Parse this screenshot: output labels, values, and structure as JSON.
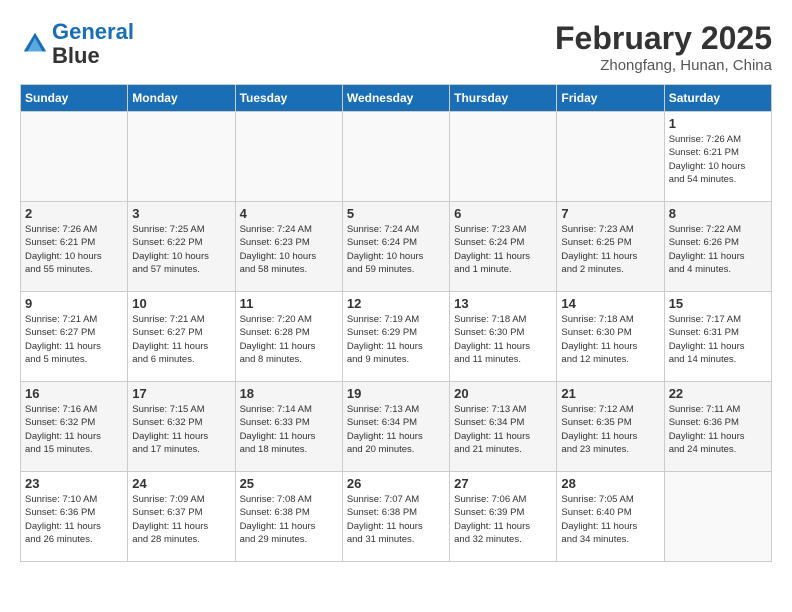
{
  "header": {
    "logo_line1": "General",
    "logo_line2": "Blue",
    "month": "February 2025",
    "location": "Zhongfang, Hunan, China"
  },
  "days_of_week": [
    "Sunday",
    "Monday",
    "Tuesday",
    "Wednesday",
    "Thursday",
    "Friday",
    "Saturday"
  ],
  "weeks": [
    [
      {
        "day": "",
        "info": ""
      },
      {
        "day": "",
        "info": ""
      },
      {
        "day": "",
        "info": ""
      },
      {
        "day": "",
        "info": ""
      },
      {
        "day": "",
        "info": ""
      },
      {
        "day": "",
        "info": ""
      },
      {
        "day": "1",
        "info": "Sunrise: 7:26 AM\nSunset: 6:21 PM\nDaylight: 10 hours\nand 54 minutes."
      }
    ],
    [
      {
        "day": "2",
        "info": "Sunrise: 7:26 AM\nSunset: 6:21 PM\nDaylight: 10 hours\nand 55 minutes."
      },
      {
        "day": "3",
        "info": "Sunrise: 7:25 AM\nSunset: 6:22 PM\nDaylight: 10 hours\nand 57 minutes."
      },
      {
        "day": "4",
        "info": "Sunrise: 7:24 AM\nSunset: 6:23 PM\nDaylight: 10 hours\nand 58 minutes."
      },
      {
        "day": "5",
        "info": "Sunrise: 7:24 AM\nSunset: 6:24 PM\nDaylight: 10 hours\nand 59 minutes."
      },
      {
        "day": "6",
        "info": "Sunrise: 7:23 AM\nSunset: 6:24 PM\nDaylight: 11 hours\nand 1 minute."
      },
      {
        "day": "7",
        "info": "Sunrise: 7:23 AM\nSunset: 6:25 PM\nDaylight: 11 hours\nand 2 minutes."
      },
      {
        "day": "8",
        "info": "Sunrise: 7:22 AM\nSunset: 6:26 PM\nDaylight: 11 hours\nand 4 minutes."
      }
    ],
    [
      {
        "day": "9",
        "info": "Sunrise: 7:21 AM\nSunset: 6:27 PM\nDaylight: 11 hours\nand 5 minutes."
      },
      {
        "day": "10",
        "info": "Sunrise: 7:21 AM\nSunset: 6:27 PM\nDaylight: 11 hours\nand 6 minutes."
      },
      {
        "day": "11",
        "info": "Sunrise: 7:20 AM\nSunset: 6:28 PM\nDaylight: 11 hours\nand 8 minutes."
      },
      {
        "day": "12",
        "info": "Sunrise: 7:19 AM\nSunset: 6:29 PM\nDaylight: 11 hours\nand 9 minutes."
      },
      {
        "day": "13",
        "info": "Sunrise: 7:18 AM\nSunset: 6:30 PM\nDaylight: 11 hours\nand 11 minutes."
      },
      {
        "day": "14",
        "info": "Sunrise: 7:18 AM\nSunset: 6:30 PM\nDaylight: 11 hours\nand 12 minutes."
      },
      {
        "day": "15",
        "info": "Sunrise: 7:17 AM\nSunset: 6:31 PM\nDaylight: 11 hours\nand 14 minutes."
      }
    ],
    [
      {
        "day": "16",
        "info": "Sunrise: 7:16 AM\nSunset: 6:32 PM\nDaylight: 11 hours\nand 15 minutes."
      },
      {
        "day": "17",
        "info": "Sunrise: 7:15 AM\nSunset: 6:32 PM\nDaylight: 11 hours\nand 17 minutes."
      },
      {
        "day": "18",
        "info": "Sunrise: 7:14 AM\nSunset: 6:33 PM\nDaylight: 11 hours\nand 18 minutes."
      },
      {
        "day": "19",
        "info": "Sunrise: 7:13 AM\nSunset: 6:34 PM\nDaylight: 11 hours\nand 20 minutes."
      },
      {
        "day": "20",
        "info": "Sunrise: 7:13 AM\nSunset: 6:34 PM\nDaylight: 11 hours\nand 21 minutes."
      },
      {
        "day": "21",
        "info": "Sunrise: 7:12 AM\nSunset: 6:35 PM\nDaylight: 11 hours\nand 23 minutes."
      },
      {
        "day": "22",
        "info": "Sunrise: 7:11 AM\nSunset: 6:36 PM\nDaylight: 11 hours\nand 24 minutes."
      }
    ],
    [
      {
        "day": "23",
        "info": "Sunrise: 7:10 AM\nSunset: 6:36 PM\nDaylight: 11 hours\nand 26 minutes."
      },
      {
        "day": "24",
        "info": "Sunrise: 7:09 AM\nSunset: 6:37 PM\nDaylight: 11 hours\nand 28 minutes."
      },
      {
        "day": "25",
        "info": "Sunrise: 7:08 AM\nSunset: 6:38 PM\nDaylight: 11 hours\nand 29 minutes."
      },
      {
        "day": "26",
        "info": "Sunrise: 7:07 AM\nSunset: 6:38 PM\nDaylight: 11 hours\nand 31 minutes."
      },
      {
        "day": "27",
        "info": "Sunrise: 7:06 AM\nSunset: 6:39 PM\nDaylight: 11 hours\nand 32 minutes."
      },
      {
        "day": "28",
        "info": "Sunrise: 7:05 AM\nSunset: 6:40 PM\nDaylight: 11 hours\nand 34 minutes."
      },
      {
        "day": "",
        "info": ""
      }
    ]
  ]
}
